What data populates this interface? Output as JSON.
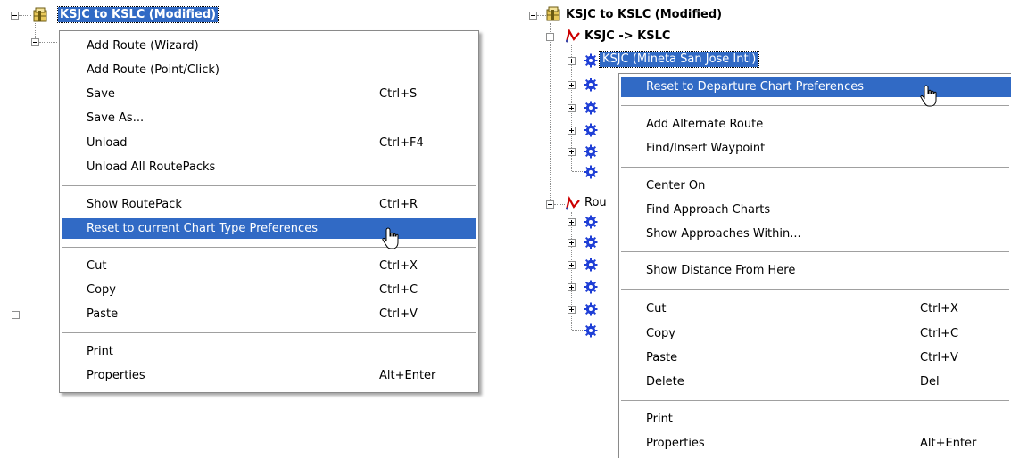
{
  "left": {
    "root_title": "KSJC to KSLC (Modified)",
    "menu": {
      "items": [
        {
          "label": "Add Route (Wizard)",
          "shortcut": ""
        },
        {
          "label": "Add Route (Point/Click)",
          "shortcut": ""
        },
        {
          "label": "Save",
          "shortcut": "Ctrl+S"
        },
        {
          "label": "Save As...",
          "shortcut": ""
        },
        {
          "label": "Unload",
          "shortcut": "Ctrl+F4"
        },
        {
          "label": "Unload All RoutePacks",
          "shortcut": ""
        },
        {
          "label": "Show RoutePack",
          "shortcut": "Ctrl+R"
        },
        {
          "label": "Reset to current Chart Type Preferences",
          "shortcut": ""
        },
        {
          "label": "Cut",
          "shortcut": "Ctrl+X"
        },
        {
          "label": "Copy",
          "shortcut": "Ctrl+C"
        },
        {
          "label": "Paste",
          "shortcut": "Ctrl+V"
        },
        {
          "label": "Print",
          "shortcut": ""
        },
        {
          "label": "Properties",
          "shortcut": "Alt+Enter"
        }
      ]
    }
  },
  "right": {
    "root_title": "KSJC to KSLC (Modified)",
    "route_title": "KSJC -> KSLC",
    "selected_node": "KSJC (Mineta San Jose Intl)",
    "second_route_partial": "Rou",
    "menu": {
      "items": [
        {
          "label": "Reset to Departure Chart Preferences",
          "shortcut": ""
        },
        {
          "label": "Add Alternate Route",
          "shortcut": ""
        },
        {
          "label": "Find/Insert Waypoint",
          "shortcut": ""
        },
        {
          "label": "Center On",
          "shortcut": ""
        },
        {
          "label": "Find Approach Charts",
          "shortcut": ""
        },
        {
          "label": "Show Approaches Within...",
          "shortcut": ""
        },
        {
          "label": "Show Distance From Here",
          "shortcut": ""
        },
        {
          "label": "Cut",
          "shortcut": "Ctrl+X"
        },
        {
          "label": "Copy",
          "shortcut": "Ctrl+C"
        },
        {
          "label": "Paste",
          "shortcut": "Ctrl+V"
        },
        {
          "label": "Delete",
          "shortcut": "Del"
        },
        {
          "label": "Print",
          "shortcut": ""
        },
        {
          "label": "Properties",
          "shortcut": "Alt+Enter"
        }
      ]
    }
  },
  "colors": {
    "highlight": "#316ac5",
    "route_icon": "#cc0000",
    "gear_icon": "#1f3fd6"
  },
  "icons": [
    "routepack-icon",
    "route-icon",
    "gear-icon",
    "hand-cursor-icon"
  ]
}
